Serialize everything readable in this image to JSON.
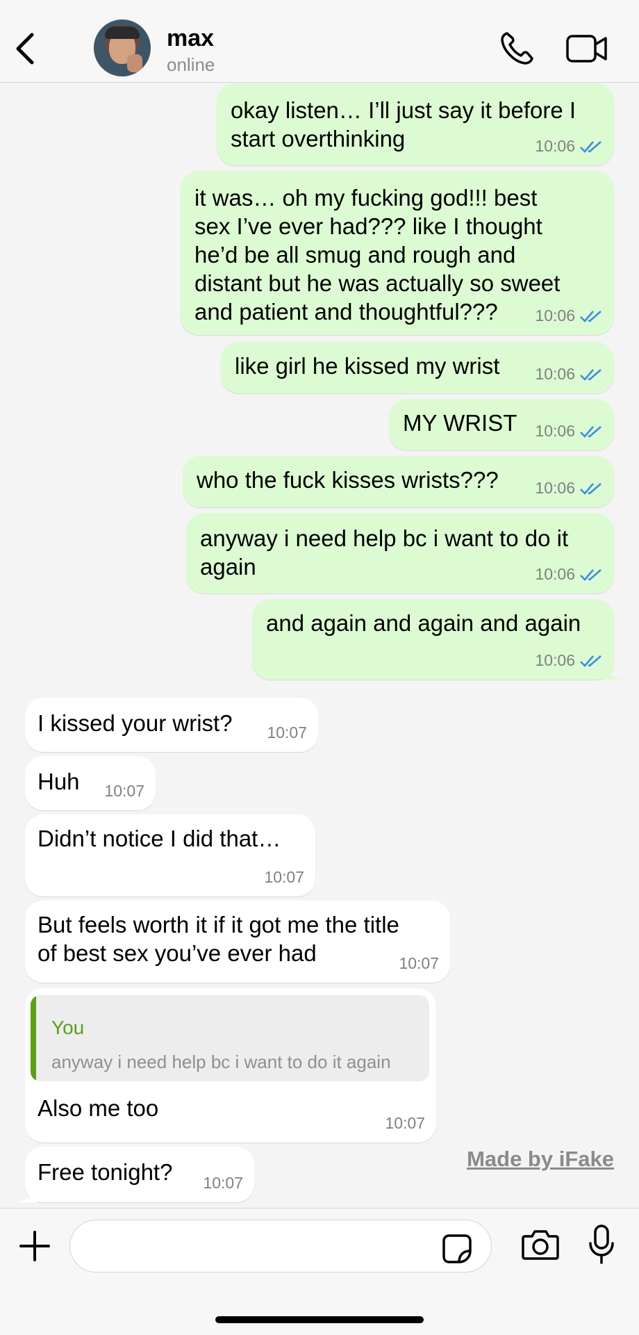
{
  "header": {
    "back_icon": "chevron-left-icon",
    "contact_name": "max",
    "contact_status": "online",
    "call_icon": "phone-icon",
    "video_icon": "video-camera-icon"
  },
  "messages": [
    {
      "direction": "outgoing",
      "lines": [
        "okay listen… I’ll just say it before I",
        "start overthinking"
      ],
      "time": "10:06",
      "read": true
    },
    {
      "direction": "outgoing",
      "lines": [
        "it was… oh my fucking god!!! best",
        "sex I’ve ever had??? like I thought",
        "he’d be all smug and rough and",
        "distant but he was actually so sweet",
        "and patient and thoughtful???"
      ],
      "time": "10:06",
      "read": true
    },
    {
      "direction": "outgoing",
      "lines": [
        "like girl he kissed my wrist"
      ],
      "time": "10:06",
      "read": true
    },
    {
      "direction": "outgoing",
      "lines": [
        "MY WRIST"
      ],
      "time": "10:06",
      "read": true
    },
    {
      "direction": "outgoing",
      "lines": [
        "who the fuck kisses wrists???"
      ],
      "time": "10:06",
      "read": true
    },
    {
      "direction": "outgoing",
      "lines": [
        "anyway i need help bc i want to do it",
        "again"
      ],
      "time": "10:06",
      "read": true
    },
    {
      "direction": "outgoing",
      "lines": [
        "and again and again and again"
      ],
      "time": "10:06",
      "read": true
    },
    {
      "direction": "incoming",
      "lines": [
        "I kissed your wrist?"
      ],
      "time": "10:07"
    },
    {
      "direction": "incoming",
      "lines": [
        "Huh"
      ],
      "time": "10:07"
    },
    {
      "direction": "incoming",
      "lines": [
        "Didn’t notice I did that…"
      ],
      "time": "10:07"
    },
    {
      "direction": "incoming",
      "lines": [
        "But feels worth it if it got me the title",
        "of best sex you’ve ever had"
      ],
      "time": "10:07"
    },
    {
      "direction": "incoming",
      "quote": {
        "author": "You",
        "text": "anyway i need help bc i want to do it again"
      },
      "lines": [
        "Also me too"
      ],
      "time": "10:07"
    },
    {
      "direction": "incoming",
      "lines": [
        "Free tonight?"
      ],
      "time": "10:07"
    }
  ],
  "watermark": "Made by iFake",
  "composer": {
    "plus_icon": "plus-icon",
    "input_value": "",
    "input_placeholder": "",
    "sticker_icon": "sticker-icon",
    "camera_icon": "camera-icon",
    "mic_icon": "microphone-icon"
  },
  "colors": {
    "outgoing_bubble": "#dcfbd3",
    "incoming_bubble": "#ffffff",
    "read_ticks": "#3c8ce0",
    "quote_accent": "#5b9e1a",
    "background": "#f4f4f4"
  }
}
